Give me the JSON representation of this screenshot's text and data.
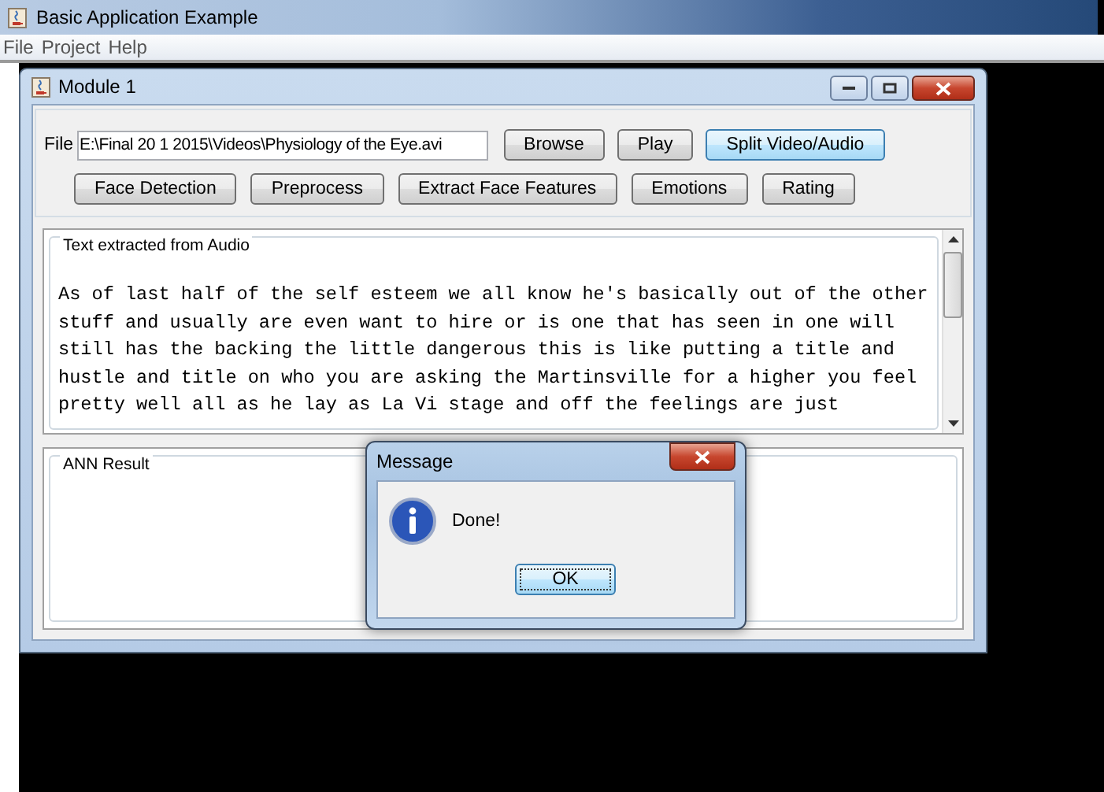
{
  "window": {
    "title": "Basic Application Example"
  },
  "menu": [
    "File",
    "Project",
    "Help"
  ],
  "module": {
    "title": "Module 1",
    "file_label": "File",
    "file_path": "E:\\Final 20 1 2015\\Videos\\Physiology of the Eye.avi",
    "button_rows": [
      [
        {
          "label": "Browse",
          "focused": false
        },
        {
          "label": "Play",
          "focused": false
        },
        {
          "label": "Split Video/Audio",
          "focused": true
        }
      ],
      [
        {
          "label": "Face Detection",
          "focused": false
        },
        {
          "label": "Preprocess",
          "focused": false
        },
        {
          "label": "Extract Face Features",
          "focused": false
        },
        {
          "label": "Emotions",
          "focused": false
        },
        {
          "label": "Rating",
          "focused": false
        }
      ]
    ],
    "audio_panel": {
      "title": "Text extracted from Audio",
      "lines": [
        "As of last half of the self esteem we all know he's basically out of the other",
        "stuff and usually are even want to hire or is one that has seen in one will",
        "still has the backing the little dangerous this is like putting a title and",
        "hustle and title on who you are asking the Martinsville for a higher you feel",
        "pretty well all as he lay as La Vi stage and off the feelings are just"
      ]
    },
    "ann_panel": {
      "title": "ANN Result"
    }
  },
  "dialog": {
    "title": "Message",
    "message": "Done!",
    "button": "OK"
  }
}
